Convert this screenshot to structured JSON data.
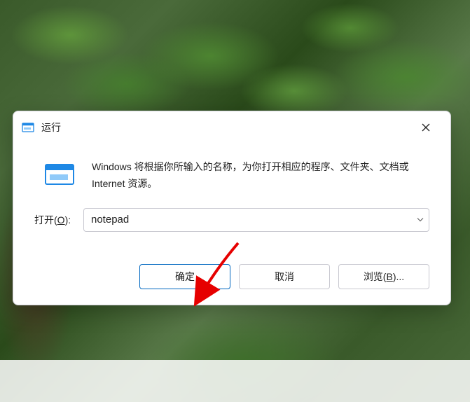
{
  "dialog": {
    "title": "运行",
    "description": "Windows 将根据你所输入的名称，为你打开相应的程序、文件夹、文档或 Internet 资源。",
    "open_label_prefix": "打开(",
    "open_label_hotkey": "O",
    "open_label_suffix": "):",
    "input_value": "notepad",
    "ok_label": "确定",
    "cancel_label": "取消",
    "browse_label_prefix": "浏览(",
    "browse_label_hotkey": "B",
    "browse_label_suffix": ")..."
  }
}
